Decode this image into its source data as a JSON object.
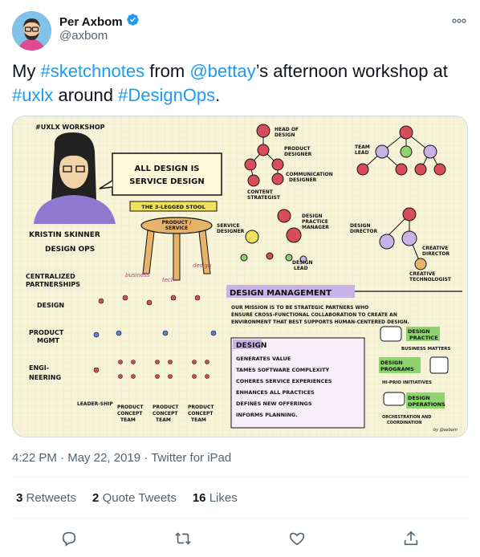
{
  "author": {
    "display_name": "Per Axbom",
    "handle": "@axbom",
    "verified": true
  },
  "tweet": {
    "segments": [
      {
        "text": "My ",
        "type": "text"
      },
      {
        "text": "#sketchnotes",
        "type": "link"
      },
      {
        "text": " from ",
        "type": "text"
      },
      {
        "text": "@bettay",
        "type": "link"
      },
      {
        "text": "’s afternoon workshop at ",
        "type": "text"
      },
      {
        "text": "#uxlx",
        "type": "link"
      },
      {
        "text": " around ",
        "type": "text"
      },
      {
        "text": "#DesignOps",
        "type": "link"
      },
      {
        "text": ".",
        "type": "text"
      }
    ]
  },
  "sketch": {
    "workshop_tag": "#UXLX WORKSHOP",
    "speech_bubble": "ALL DESIGN IS SERVICE DESIGN",
    "speaker": "KRISTIN SKINNER DESIGN OPS",
    "stool_label": "THE 3-LEGGED STOOL",
    "stool_top": "PRODUCT / SERVICE",
    "stool_legs": [
      "business",
      "tech",
      "design"
    ],
    "centralized": "CENTRALIZED PARTNERSHIPS",
    "rows": [
      "DESIGN",
      "PRODUCT MGMT",
      "ENGI-NEERING"
    ],
    "leadership": "LEADER-SHIP",
    "teams": [
      "PRODUCT CONCEPT TEAM",
      "PRODUCT CONCEPT TEAM",
      "PRODUCT CONCEPT TEAM"
    ],
    "org_labels": [
      "HEAD OF DESIGN",
      "PRODUCT DESIGNER",
      "COMMUNICATION DESIGNER",
      "CONTENT STRATEGIST",
      "TEAM LEAD",
      "SERVICE DESIGNER",
      "DESIGN PRACTICE MANAGER",
      "DESIGN LEAD",
      "DESIGN DIRECTOR",
      "CREATIVE DIRECTOR",
      "CREATIVE TECHNOLOGIST"
    ],
    "dm_title": "DESIGN MANAGEMENT",
    "dm_mission": "OUR MISSION IS TO BE STRATEGIC PARTNERS WHO ENSURE CROSS-FUNCTIONAL COLLABORATION TO CREATE AN ENVIRONMENT THAT BEST SUPPORTS HUMAN-CENTERED DESIGN.",
    "design_box_title": "DESIGN",
    "design_box_items": [
      "GENERATES VALUE",
      "TAMES SOFTWARE COMPLEXITY",
      "COHERES SERVICE EXPERIENCES",
      "ENHANCES ALL PRACTICES",
      "DEFINES NEW OFFERINGS",
      "INFORMS PLANNING."
    ],
    "side_items": [
      {
        "title": "DESIGN PRACTICE",
        "sub": "BUSINESS MATTERS"
      },
      {
        "title": "DESIGN PROGRAMS",
        "sub": "HI-PRIO INITIATIVES"
      },
      {
        "title": "DESIGN OPERATIONS",
        "sub": "ORCHESTRATION AND COORDINATION"
      }
    ],
    "signature": "by @axbom"
  },
  "meta": {
    "time": "4:22 PM",
    "date": "May 22, 2019",
    "source": "Twitter for iPad",
    "separator": "·"
  },
  "stats": [
    {
      "count": "3",
      "label": "Retweets"
    },
    {
      "count": "2",
      "label": "Quote Tweets"
    },
    {
      "count": "16",
      "label": "Likes"
    }
  ],
  "icons": {
    "verified": "verified-badge-icon",
    "more": "more-icon",
    "reply": "reply-icon",
    "retweet": "retweet-icon",
    "like": "like-icon",
    "share": "share-icon"
  },
  "colors": {
    "link": "#1d9bf0",
    "text": "#0f1419",
    "secondary": "#536471",
    "sketch_bg": "#f7f3d8",
    "sketch_purple": "#c9b3e6",
    "sketch_green": "#8cd46b",
    "sketch_red": "#d74d5b",
    "sketch_yellow": "#f1e25d"
  }
}
